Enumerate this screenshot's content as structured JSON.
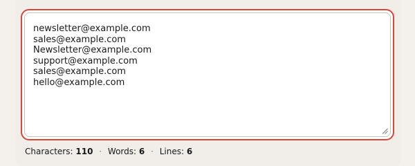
{
  "emails": [
    "newsletter@example.com",
    "sales@example.com",
    "Newsletter@example.com",
    "support@example.com",
    "sales@example.com",
    "hello@example.com"
  ],
  "stats": {
    "characters_label": "Characters:",
    "characters_value": "110",
    "words_label": "Words:",
    "words_value": "6",
    "lines_label": "Lines:",
    "lines_value": "6"
  },
  "colors": {
    "focus_border": "#d7473a",
    "background": "#f4f1ec"
  },
  "icons": {
    "resize": "resize-handle-icon"
  }
}
